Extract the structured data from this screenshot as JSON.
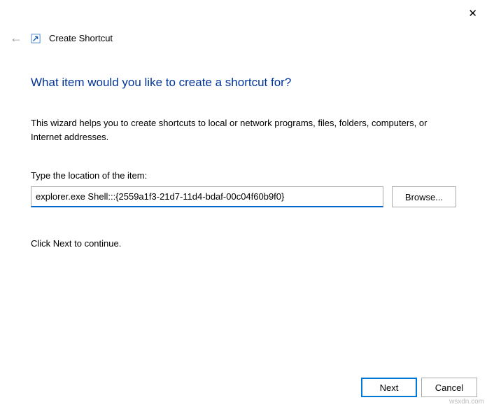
{
  "close_symbol": "✕",
  "back_symbol": "←",
  "header": {
    "title": "Create Shortcut"
  },
  "main": {
    "heading": "What item would you like to create a shortcut for?",
    "description": "This wizard helps you to create shortcuts to local or network programs, files, folders, computers, or Internet addresses.",
    "field_label": "Type the location of the item:",
    "location_value": "explorer.exe Shell:::{2559a1f3-21d7-11d4-bdaf-00c04f60b9f0}",
    "browse_label": "Browse...",
    "continue_text": "Click Next to continue."
  },
  "footer": {
    "next_label": "Next",
    "cancel_label": "Cancel"
  },
  "watermark": "wsxdn.com"
}
